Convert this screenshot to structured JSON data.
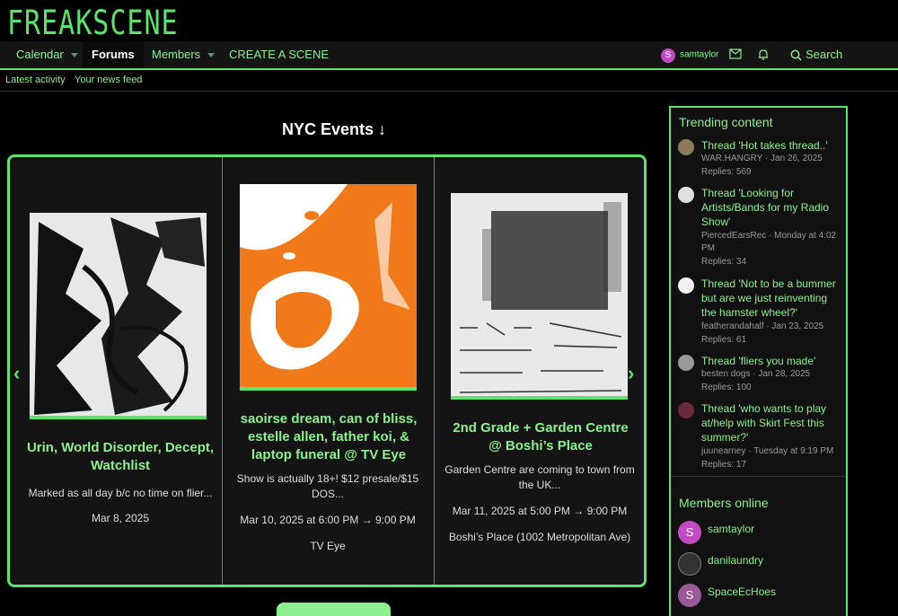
{
  "logo": {
    "text": "FREAKSCENE"
  },
  "nav": {
    "items": [
      {
        "label": "Calendar"
      },
      {
        "label": "Forums"
      },
      {
        "label": "Members"
      },
      {
        "label": "CREATE A SCENE"
      }
    ],
    "user": {
      "initial": "S",
      "name": "samtaylor"
    },
    "search_label": "Search"
  },
  "subnav": {
    "items": [
      {
        "label": "Latest activity"
      },
      {
        "label": "Your news feed"
      }
    ]
  },
  "events": {
    "heading": "NYC Events ↓",
    "cards": [
      {
        "title": "Urin, World Disorder, Decept, Watchlist",
        "desc": "Marked as all day b/c no time on flier...",
        "date": "Mar 8, 2025",
        "location": ""
      },
      {
        "title": "saoirse dream, can of bliss, estelle allen, father koi, & laptop funeral @ TV Eye",
        "desc": "Show is actually 18+! $12 presale/$15 DOS...",
        "date": "Mar 10, 2025 at 6:00 PM → 9:00 PM",
        "location": "TV Eye"
      },
      {
        "title": "2nd Grade + Garden Centre @ Boshi’s Place",
        "desc": "Garden Centre are coming to town from the UK...",
        "date": "Mar 11, 2025 at 5:00 PM → 9:00 PM",
        "location": "Boshi’s Place (1002 Metropolitan Ave)"
      }
    ],
    "prev_arrow": "‹",
    "next_arrow": "›"
  },
  "trending": {
    "heading": "Trending content",
    "items": [
      {
        "title": "Thread 'Hot takes thread..'",
        "meta": "WAR.HANGRY · Jan 26, 2025",
        "replies": "Replies: 569"
      },
      {
        "title": "Thread 'Looking for Artists/Bands for my Radio Show'",
        "meta": "PiercedEarsRec · Monday at 4:02 PM",
        "replies": "Replies: 34"
      },
      {
        "title": "Thread 'Not to be a bummer but are we just reinventing the hamster wheel?'",
        "meta": "featherandahalf · Jan 23, 2025",
        "replies": "Replies: 61"
      },
      {
        "title": "Thread 'fliers you made'",
        "meta": "besten dogs · Jan 28, 2025",
        "replies": "Replies: 100"
      },
      {
        "title": "Thread 'who wants to play at/help with Skirt Fest this summer?'",
        "meta": "juunearney · Tuesday at 9:19 PM",
        "replies": "Replies: 17"
      }
    ]
  },
  "members_online": {
    "heading": "Members online",
    "items": [
      {
        "initial": "S",
        "name": "samtaylor",
        "color": "#c24ac2"
      },
      {
        "initial": "",
        "name": "danilaundry",
        "color": "#333333"
      },
      {
        "initial": "S",
        "name": "SpaceEcHoes",
        "color": "#9a5a9a"
      }
    ]
  },
  "colors": {
    "accent": "#5ee36a",
    "link": "#8df08f",
    "orange": "#f07a1a"
  }
}
